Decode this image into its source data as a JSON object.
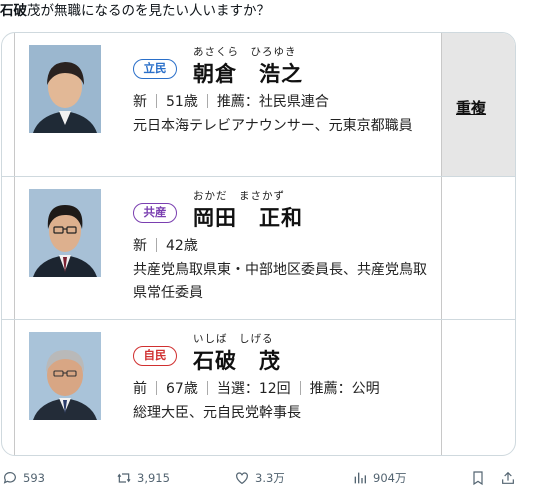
{
  "post": {
    "text_bold": "石破",
    "text_rest": "茂が無職になるのを見たい人いますか？"
  },
  "candidates": [
    {
      "party": "立民",
      "party_color": "#2a6fc9",
      "furigana": "あさくら　ひろゆき",
      "name": "朝倉　浩之",
      "status": "新",
      "age": "51歳",
      "extra": "推薦：社民県連合",
      "desc": "元日本海テレビアナウンサー、元東京都職員",
      "duplicate": "重複"
    },
    {
      "party": "共産",
      "party_color": "#7a3fb0",
      "furigana": "おかだ　まさかず",
      "name": "岡田　正和",
      "status": "新",
      "age": "42歳",
      "desc": "共産党鳥取県東・中部地区委員長、共産党鳥取県常任委員"
    },
    {
      "party": "自民",
      "party_color": "#d03030",
      "furigana": "いしば　しげる",
      "name": "石破　茂",
      "status": "前",
      "age": "67歳",
      "elected": "当選：12回",
      "extra": "推薦：公明",
      "desc": "総理大臣、元自民党幹事長"
    }
  ],
  "actions": {
    "replies": "593",
    "reposts": "3,915",
    "likes": "3.3万",
    "views": "904万"
  },
  "icons": [
    "reply-icon",
    "repost-icon",
    "like-icon",
    "views-icon",
    "bookmark-icon",
    "share-icon"
  ]
}
